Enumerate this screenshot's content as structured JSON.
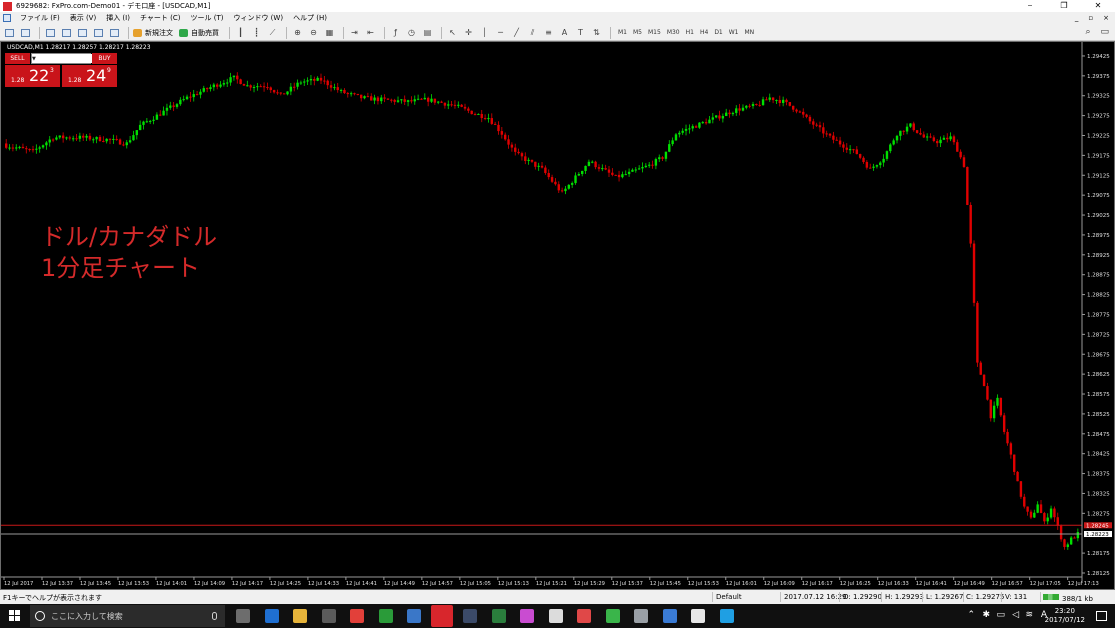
{
  "window": {
    "title": "6929682: FxPro.com-Demo01 - デモ口座 - [USDCAD,M1]",
    "controls": [
      "⎯",
      "❐",
      "✕"
    ],
    "mdi_controls": [
      "_",
      "▫",
      "×"
    ]
  },
  "menu": {
    "items": [
      "ファイル (F)",
      "表示 (V)",
      "挿入 (I)",
      "チャート (C)",
      "ツール (T)",
      "ウィンドウ (W)",
      "ヘルプ (H)"
    ]
  },
  "toolbar": {
    "new_order": "新規注文",
    "auto_trading": "自動売買",
    "timeframes": [
      "M1",
      "M5",
      "M15",
      "M30",
      "H1",
      "H4",
      "D1",
      "W1",
      "MN"
    ]
  },
  "chart": {
    "symbol_header": "USDCAD,M1  1.28217 1.28257 1.28217 1.28223",
    "annotation_line1": "ドル/カナダドル",
    "annotation_line2": "1分足チャート",
    "current_price_label": "1.28223",
    "red_line_label": "1.28245"
  },
  "trade_panel": {
    "sell_label": "SELL",
    "buy_label": "BUY",
    "lot_value": "0.10",
    "bid_prefix": "1.28",
    "bid_big": "22",
    "bid_sup": "3",
    "ask_prefix": "1.28",
    "ask_big": "24",
    "ask_sup": "9"
  },
  "chart_data": {
    "type": "candlestick",
    "title": "",
    "xlabel": "",
    "ylabel": "",
    "ylim": [
      1.28125,
      1.29445
    ],
    "up_color": "#00e000",
    "down_color": "#e00000",
    "background": "#000000",
    "grid": false,
    "y_ticks": [
      "1.29425",
      "1.29375",
      "1.29325",
      "1.29275",
      "1.29225",
      "1.29175",
      "1.29125",
      "1.29075",
      "1.29025",
      "1.28975",
      "1.28925",
      "1.28875",
      "1.28825",
      "1.28775",
      "1.28725",
      "1.28675",
      "1.28625",
      "1.28575",
      "1.28525",
      "1.28475",
      "1.28425",
      "1.28375",
      "1.28325",
      "1.28275",
      "1.28175",
      "1.28125"
    ],
    "x_ticks": [
      "12 Jul 2017",
      "12 Jul 13:37",
      "12 Jul 13:45",
      "12 Jul 13:53",
      "12 Jul 14:01",
      "12 Jul 14:09",
      "12 Jul 14:17",
      "12 Jul 14:25",
      "12 Jul 14:33",
      "12 Jul 14:41",
      "12 Jul 14:49",
      "12 Jul 14:57",
      "12 Jul 15:05",
      "12 Jul 15:13",
      "12 Jul 15:21",
      "12 Jul 15:29",
      "12 Jul 15:37",
      "12 Jul 15:45",
      "12 Jul 15:53",
      "12 Jul 16:01",
      "12 Jul 16:09",
      "12 Jul 16:17",
      "12 Jul 16:25",
      "12 Jul 16:33",
      "12 Jul 16:41",
      "12 Jul 16:49",
      "12 Jul 16:57",
      "12 Jul 17:05",
      "12 Jul 17:13"
    ],
    "close_path": [
      [
        0,
        1.292
      ],
      [
        8,
        1.29185
      ],
      [
        14,
        1.2922
      ],
      [
        22,
        1.2922
      ],
      [
        30,
        1.29215
      ],
      [
        36,
        1.29205
      ],
      [
        40,
        1.2925
      ],
      [
        44,
        1.2927
      ],
      [
        50,
        1.293
      ],
      [
        54,
        1.2932
      ],
      [
        62,
        1.2935
      ],
      [
        68,
        1.2937
      ],
      [
        72,
        1.2935
      ],
      [
        78,
        1.2935
      ],
      [
        82,
        1.29325
      ],
      [
        88,
        1.2936
      ],
      [
        94,
        1.29365
      ],
      [
        100,
        1.29335
      ],
      [
        106,
        1.2932
      ],
      [
        112,
        1.29315
      ],
      [
        120,
        1.2931
      ],
      [
        126,
        1.29315
      ],
      [
        134,
        1.293
      ],
      [
        140,
        1.2928
      ],
      [
        144,
        1.2927
      ],
      [
        148,
        1.2923
      ],
      [
        152,
        1.2918
      ],
      [
        156,
        1.2916
      ],
      [
        160,
        1.2914
      ],
      [
        166,
        1.2908
      ],
      [
        170,
        1.2912
      ],
      [
        174,
        1.2916
      ],
      [
        178,
        1.2914
      ],
      [
        182,
        1.2912
      ],
      [
        186,
        1.2913
      ],
      [
        192,
        1.2915
      ],
      [
        196,
        1.2917
      ],
      [
        200,
        1.2923
      ],
      [
        206,
        1.2925
      ],
      [
        212,
        1.2927
      ],
      [
        218,
        1.2929
      ],
      [
        224,
        1.293
      ],
      [
        228,
        1.2932
      ],
      [
        232,
        1.2931
      ],
      [
        236,
        1.2929
      ],
      [
        240,
        1.2926
      ],
      [
        246,
        1.2922
      ],
      [
        250,
        1.292
      ],
      [
        254,
        1.2918
      ],
      [
        258,
        1.2914
      ],
      [
        262,
        1.2917
      ],
      [
        266,
        1.2923
      ],
      [
        270,
        1.2925
      ],
      [
        274,
        1.2922
      ],
      [
        278,
        1.2921
      ],
      [
        282,
        1.2922
      ],
      [
        284,
        1.2919
      ],
      [
        286,
        1.2915
      ],
      [
        287,
        1.2905
      ],
      [
        288,
        1.2895
      ],
      [
        289,
        1.288
      ],
      [
        290,
        1.2865
      ],
      [
        292,
        1.286
      ],
      [
        294,
        1.2852
      ],
      [
        296,
        1.2856
      ],
      [
        298,
        1.2848
      ],
      [
        300,
        1.2842
      ],
      [
        302,
        1.2835
      ],
      [
        304,
        1.2829
      ],
      [
        306,
        1.2826
      ],
      [
        308,
        1.283
      ],
      [
        310,
        1.2825
      ],
      [
        312,
        1.2829
      ],
      [
        314,
        1.2824
      ],
      [
        316,
        1.2819
      ],
      [
        318,
        1.2821
      ],
      [
        320,
        1.28223
      ]
    ]
  },
  "statusbar": {
    "help": "F1キーでヘルプが表示されます",
    "profile": "Default",
    "datetime": "2017.07.12 16:29",
    "open": "O: 1.29290",
    "high": "H: 1.29293",
    "low": "L: 1.29267",
    "close": "C: 1.29275",
    "volume": "V: 131",
    "connection": "388/1 kb"
  },
  "taskbar": {
    "search_placeholder": "ここに入力して検索",
    "time": "23:20",
    "date": "2017/07/12",
    "ime": "A",
    "app_colors": [
      "#6d6d6d",
      "#1f6fd1",
      "#e7b43a",
      "#5b5b5b",
      "#e2403a",
      "#2a9b39",
      "#3a77c8",
      "#d8262c",
      "#3b4a68",
      "#2a7d3c",
      "#c94cd1",
      "#dcdcdc",
      "#e04848",
      "#3ab54a",
      "#9aa0a6",
      "#3a7bd5",
      "#e6e6e6",
      "#1f9fe3"
    ]
  }
}
